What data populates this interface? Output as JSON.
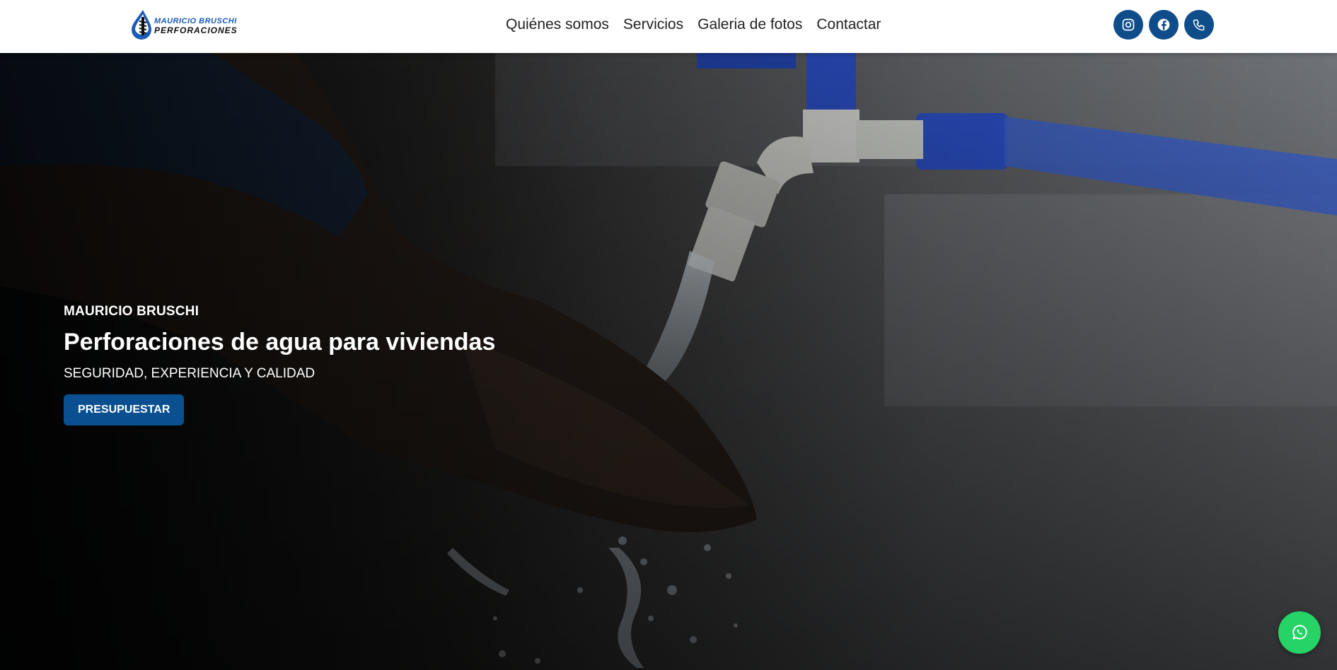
{
  "header": {
    "logo": {
      "line1": "MAURICIO BRUSCHI",
      "line2": "PERFORACIONES"
    },
    "nav": [
      {
        "label": "Quiénes somos"
      },
      {
        "label": "Servicios"
      },
      {
        "label": "Galeria de fotos"
      },
      {
        "label": "Contactar"
      }
    ],
    "social": [
      {
        "icon": "instagram-icon"
      },
      {
        "icon": "facebook-icon"
      },
      {
        "icon": "phone-icon"
      }
    ]
  },
  "hero": {
    "brand": "MAURICIO BRUSCHI",
    "headline": "Perforaciones de agua para viviendas",
    "tagline": "SEGURIDAD, EXPERIENCIA Y CALIDAD",
    "cta_label": "PRESUPUESTAR"
  },
  "floating": {
    "whatsapp_icon": "whatsapp-icon"
  },
  "colors": {
    "brand_blue": "#0f4c8a",
    "cta_blue": "#0a4f8f",
    "whatsapp_green": "#25d366"
  }
}
